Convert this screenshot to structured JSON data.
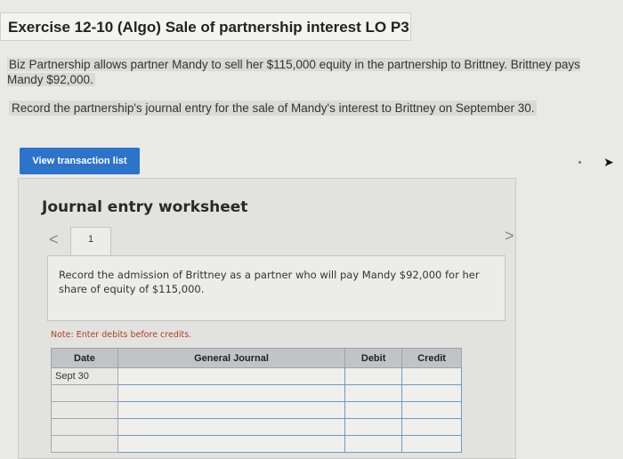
{
  "header": {
    "title": "Exercise 12-10 (Algo) Sale of partnership interest LO P3"
  },
  "question": {
    "text": "Biz Partnership allows partner Mandy to sell her $115,000 equity in the partnership to Brittney. Brittney pays Mandy $92,000.",
    "task": "Record the partnership's journal entry for the sale of Mandy's interest to Brittney on September 30."
  },
  "buttons": {
    "view_transactions": "View transaction list"
  },
  "worksheet": {
    "title": "Journal entry worksheet",
    "tab_number": "1",
    "instruction": "Record the admission of Brittney as a partner who will pay Mandy $92,000 for her share of equity of $115,000.",
    "note": "Note: Enter debits before credits.",
    "nav_prev": "<",
    "nav_next": ">",
    "table": {
      "headers": [
        "Date",
        "General Journal",
        "Debit",
        "Credit"
      ],
      "rows": [
        {
          "date": "Sept 30",
          "account": "",
          "debit": "",
          "credit": ""
        },
        {
          "date": "",
          "account": "",
          "debit": "",
          "credit": ""
        },
        {
          "date": "",
          "account": "",
          "debit": "",
          "credit": ""
        },
        {
          "date": "",
          "account": "",
          "debit": "",
          "credit": ""
        },
        {
          "date": "",
          "account": "",
          "debit": "",
          "credit": ""
        }
      ]
    }
  },
  "colors": {
    "accent": "#2b74c9",
    "note": "#b43c20"
  }
}
